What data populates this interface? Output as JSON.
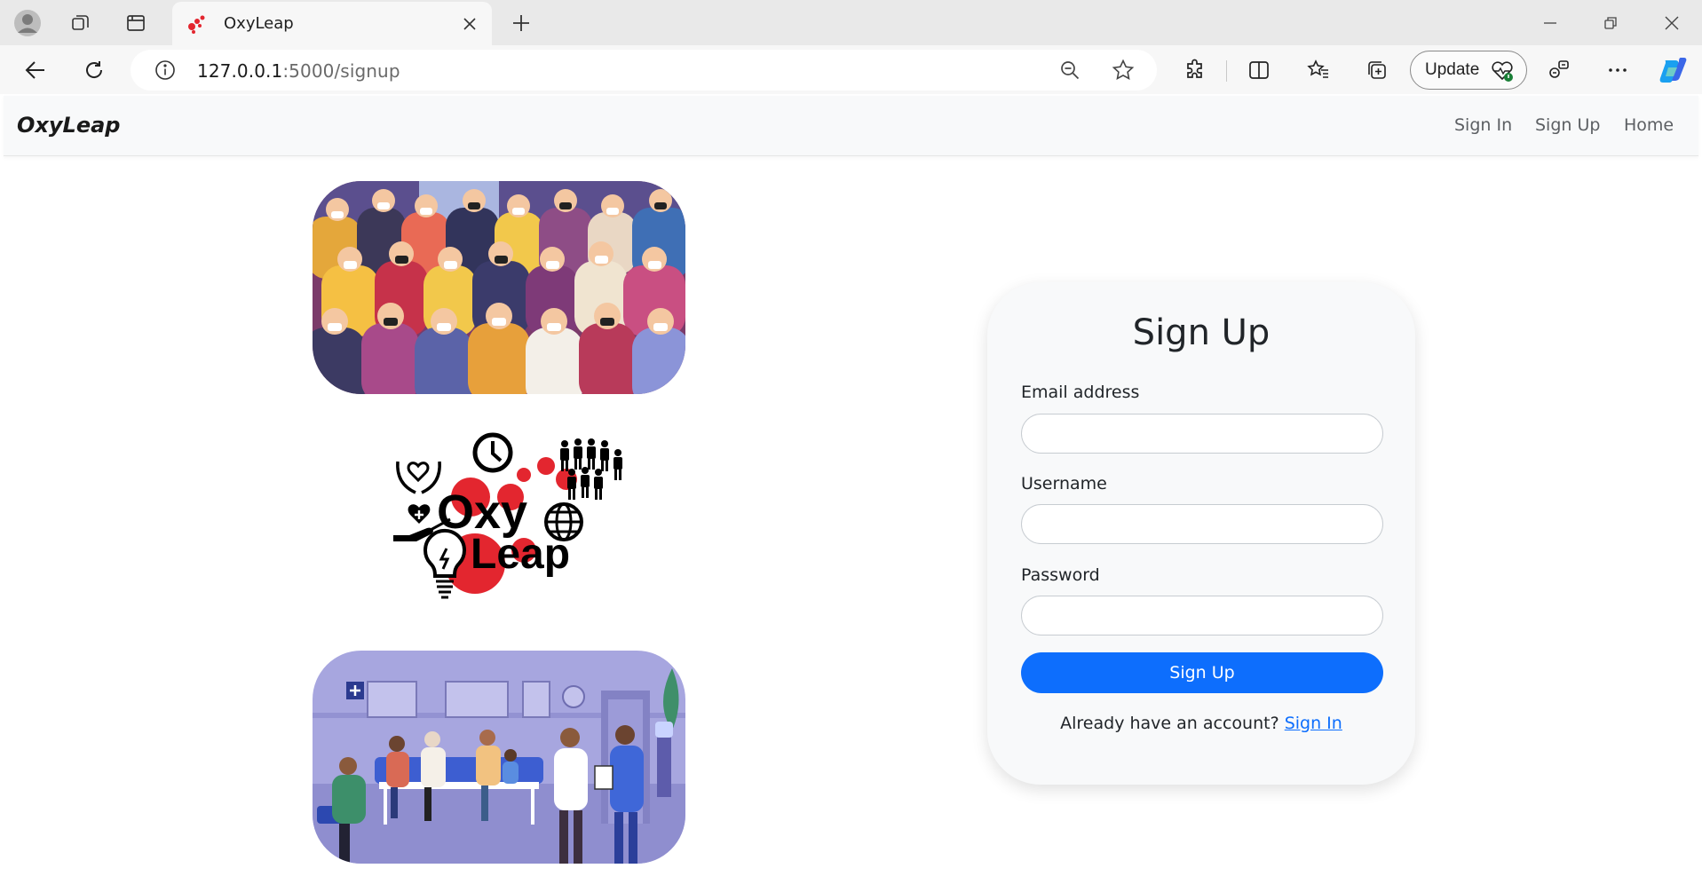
{
  "browser": {
    "tab_title": "OxyLeap",
    "url_host": "127.0.0.1",
    "url_rest": ":5000/signup",
    "update_label": "Update"
  },
  "navbar": {
    "brand": "OxyLeap",
    "links": [
      {
        "label": "Sign In"
      },
      {
        "label": "Sign Up"
      },
      {
        "label": "Home"
      }
    ]
  },
  "logo": {
    "line1": "Oxy",
    "line2": "Leap"
  },
  "form": {
    "title": "Sign Up",
    "email_label": "Email address",
    "username_label": "Username",
    "password_label": "Password",
    "submit_label": "Sign Up",
    "footer_text": "Already have an account?",
    "footer_link": "Sign In"
  },
  "colors": {
    "primary": "#0d6efd",
    "navbar_bg": "#f8f9fa",
    "logo_red": "#e3262f"
  },
  "icons": [
    "profile-icon",
    "workspaces-icon",
    "tab-actions-icon",
    "favicon",
    "close-icon",
    "plus-icon",
    "minimize-icon",
    "restore-icon",
    "window-close-icon",
    "back-icon",
    "refresh-icon",
    "info-icon",
    "zoom-out-icon",
    "star-icon",
    "extensions-icon",
    "split-screen-icon",
    "favorites-icon",
    "collections-icon",
    "health-icon",
    "copilot-icon",
    "more-icon"
  ]
}
